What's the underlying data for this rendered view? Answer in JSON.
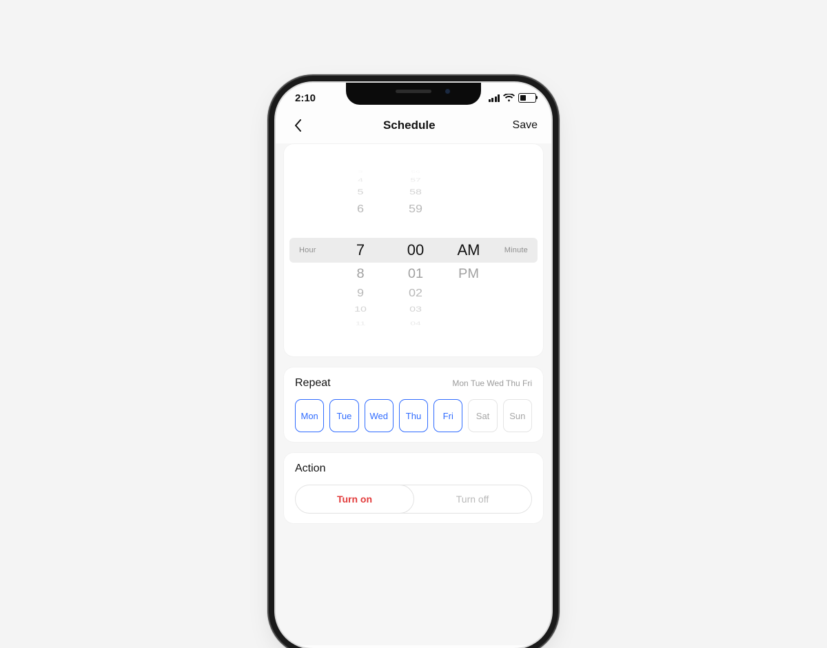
{
  "status": {
    "time": "2:10"
  },
  "nav": {
    "title": "Schedule",
    "save": "Save"
  },
  "picker": {
    "hour_label": "Hour",
    "minute_label": "Minute",
    "hours": {
      "m5": "3",
      "m4": "4",
      "m3": "5",
      "m2": "6",
      "sel": "7",
      "p1": "8",
      "p2": "9",
      "p3": "10",
      "p4": "11"
    },
    "minutes": {
      "m5": "56",
      "m4": "57",
      "m3": "58",
      "m2": "59",
      "sel": "00",
      "p1": "01",
      "p2": "02",
      "p3": "03",
      "p4": "04"
    },
    "ampm": {
      "sel": "AM",
      "p1": "PM"
    }
  },
  "repeat": {
    "label": "Repeat",
    "summary": "Mon Tue Wed Thu Fri",
    "days": {
      "mon": "Mon",
      "tue": "Tue",
      "wed": "Wed",
      "thu": "Thu",
      "fri": "Fri",
      "sat": "Sat",
      "sun": "Sun"
    }
  },
  "action": {
    "label": "Action",
    "on": "Turn on",
    "off": "Turn off"
  }
}
